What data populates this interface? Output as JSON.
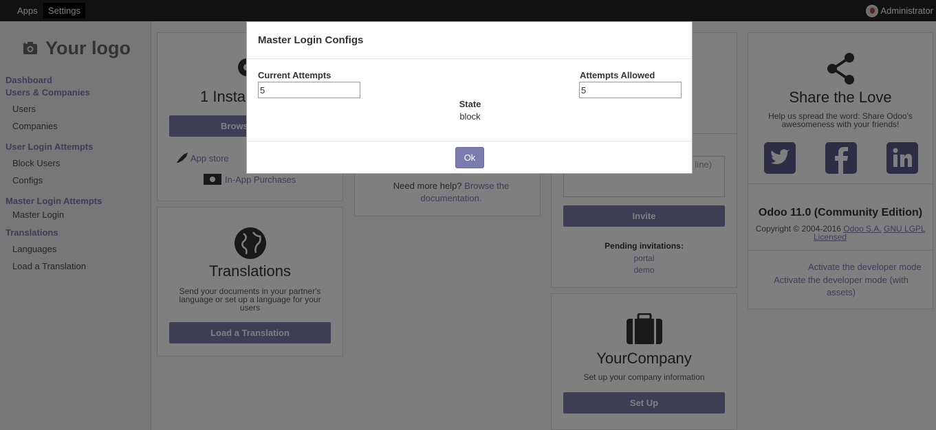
{
  "topbar": {
    "apps": "Apps",
    "settings": "Settings",
    "user": "Administrator"
  },
  "sidebar": {
    "logo": "Your logo",
    "sections": [
      {
        "label": "Dashboard"
      },
      {
        "label": "Users & Companies",
        "items": [
          "Users",
          "Companies"
        ]
      },
      {
        "label": "User Login Attempts",
        "items": [
          "Block Users",
          "Configs"
        ]
      },
      {
        "label": "Master Login Attempts",
        "items": [
          "Master Login"
        ]
      },
      {
        "label": "Translations",
        "items": [
          "Languages",
          "Load a Translation"
        ]
      }
    ]
  },
  "apps_card": {
    "installed": "1 Insta",
    "browse_button": "Brows",
    "app_store": "App store",
    "in_app_purchases": "In-App Purchases"
  },
  "translations_card": {
    "title": "Translations",
    "description": "Send your documents in your partner's language or set up a language for your users",
    "button": "Load a Translation"
  },
  "help_card": {
    "text": "Need more help?",
    "link": "Browse the documentation."
  },
  "invite_card": {
    "placeholder_tail": "line)",
    "invite_button": "Invite",
    "pending_label": "Pending invitations:",
    "pending": [
      "portal",
      "demo"
    ]
  },
  "company_card": {
    "title": "YourCompany",
    "description": "Set up your company information",
    "button": "Set Up"
  },
  "share_card": {
    "title": "Share the Love",
    "description": "Help us spread the word: Share Odoo's awesomeness with your friends!",
    "version": "Odoo 11.0 (Community Edition)",
    "copyright": "Copyright © 2004-2016",
    "company_link": "Odoo S.A.",
    "license_link_1": "GNU LGPL",
    "license_link_2": "Licensed",
    "dev_mode": "Activate the developer mode",
    "dev_mode_assets": "Activate the developer mode (with assets)"
  },
  "dialog": {
    "title": "Master Login Configs",
    "current_attempts_label": "Current Attempts",
    "current_attempts_value": "5",
    "attempts_allowed_label": "Attempts Allowed",
    "attempts_allowed_value": "5",
    "state_label": "State",
    "state_value": "block",
    "ok_button": "Ok"
  },
  "colors": {
    "accent": "#7c7bad",
    "topbar": "#222222"
  }
}
